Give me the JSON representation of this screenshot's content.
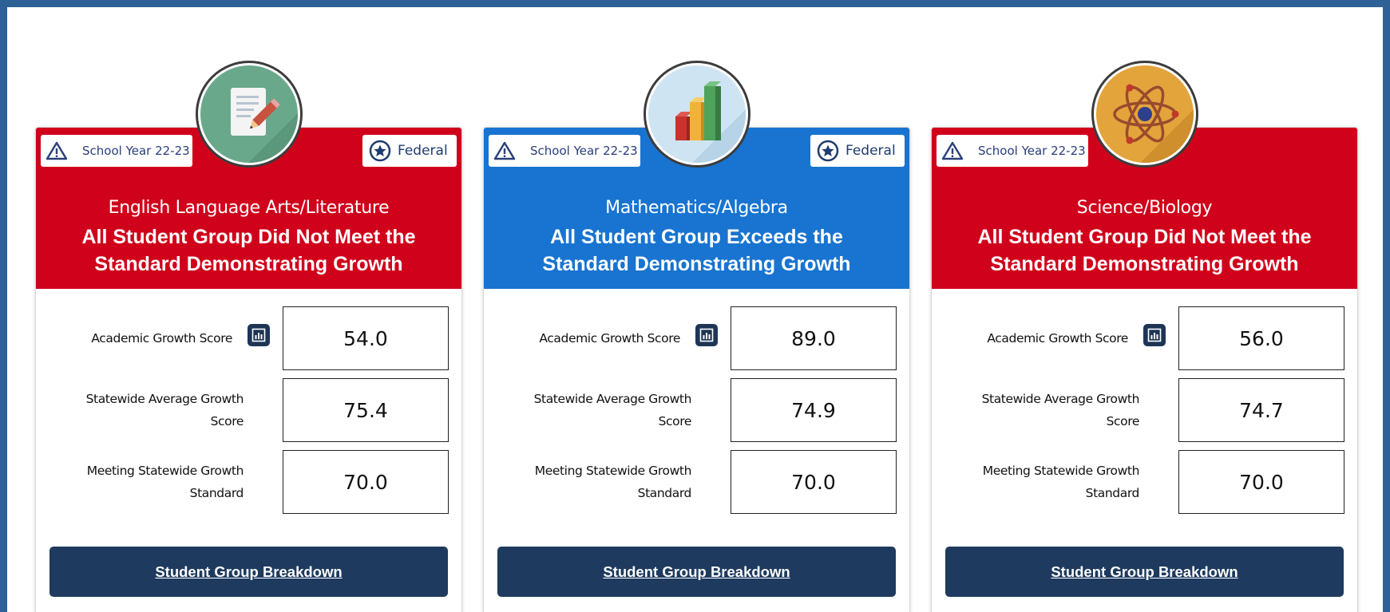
{
  "colors": {
    "page_border": "#2e6296",
    "not_met": "#d0021b",
    "exceeds": "#1874d0",
    "button": "#1e3a5f"
  },
  "cards": [
    {
      "school_year": "School Year 22-23",
      "federal_label": "Federal",
      "subject": "English Language Arts/Literature",
      "status": "All Student Group Did Not Meet the Standard Demonstrating Growth",
      "status_color": "red",
      "icon": "document-pencil-icon",
      "rows": [
        {
          "label": "Academic Growth Score",
          "value": "54.0"
        },
        {
          "label": "Statewide Average Growth Score",
          "value": "75.4"
        },
        {
          "label": "Meeting Statewide Growth Standard",
          "value": "70.0"
        }
      ],
      "button": "Student Group Breakdown"
    },
    {
      "school_year": "School Year 22-23",
      "federal_label": "Federal",
      "subject": "Mathematics/Algebra",
      "status": "All Student Group Exceeds the Standard Demonstrating Growth",
      "status_color": "blue",
      "icon": "bar-chart-icon",
      "rows": [
        {
          "label": "Academic Growth Score",
          "value": "89.0"
        },
        {
          "label": "Statewide Average Growth Score",
          "value": "74.9"
        },
        {
          "label": "Meeting Statewide Growth Standard",
          "value": "70.0"
        }
      ],
      "button": "Student Group Breakdown"
    },
    {
      "school_year": "School Year 22-23",
      "federal_label": "",
      "subject": "Science/Biology",
      "status": "All Student Group Did Not Meet the Standard Demonstrating Growth",
      "status_color": "red",
      "icon": "atom-icon",
      "rows": [
        {
          "label": "Academic Growth Score",
          "value": "56.0"
        },
        {
          "label": "Statewide Average Growth Score",
          "value": "74.7"
        },
        {
          "label": "Meeting Statewide Growth Standard",
          "value": "70.0"
        }
      ],
      "button": "Student Group Breakdown"
    }
  ]
}
